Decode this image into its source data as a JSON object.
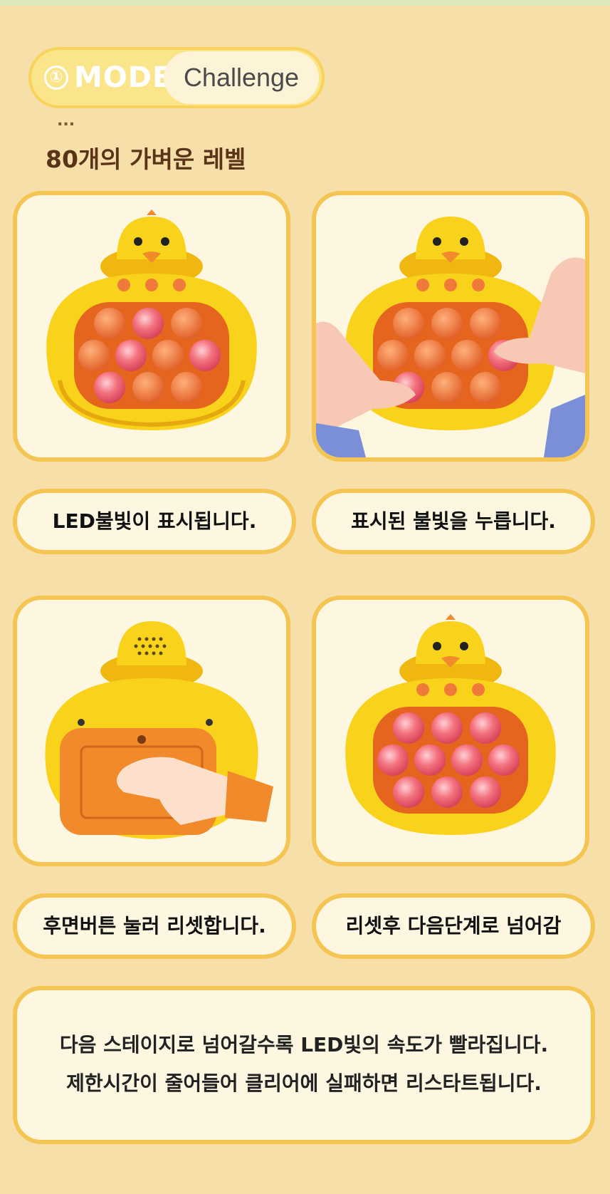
{
  "mode": {
    "number": "①",
    "label": "MODE",
    "value": "Challenge"
  },
  "ellipsis": "...",
  "subtitle": "80개의 가벼운 레벨",
  "steps": [
    {
      "caption": "LED불빛이 표시됩니다."
    },
    {
      "caption": "표시된 불빛을 누릅니다."
    },
    {
      "caption": "후면버튼 눌러 리셋합니다."
    },
    {
      "caption": "리셋후 다음단계로 넘어감"
    }
  ],
  "note": {
    "line1": "다음 스테이지로 넘어갈수록 LED빛의 속도가 빨라집니다.",
    "line2": "제한시간이 줄어들어 클리어에 실패하면 리스타트됩니다."
  },
  "colors": {
    "background": "#f7dfa9",
    "frame": "#f4c552",
    "toy_yellow": "#f9d21c",
    "bubble": "#ef7a3a",
    "lit_bubble": "#f26a78"
  }
}
